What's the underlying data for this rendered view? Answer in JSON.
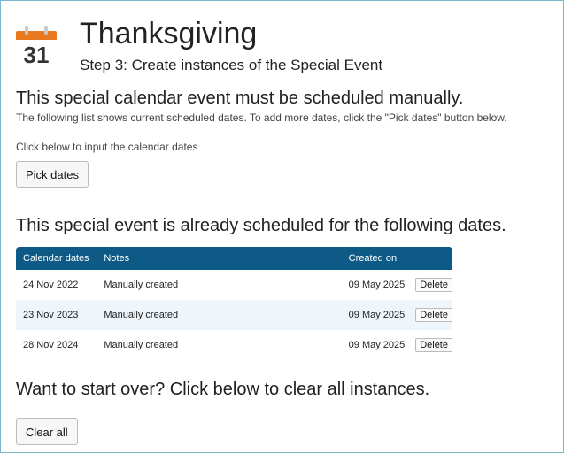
{
  "header": {
    "icon_day": "31",
    "title": "Thanksgiving",
    "subtitle": "Step 3: Create instances of the Special Event"
  },
  "manual": {
    "heading": "This special calendar event must be scheduled manually.",
    "description": "The following list shows current scheduled dates. To add more dates, click the \"Pick dates\" button below.",
    "instruction": "Click below to input the calendar dates",
    "pick_button": "Pick dates"
  },
  "scheduled": {
    "heading": "This special event is already scheduled for the following dates.",
    "columns": [
      "Calendar dates",
      "Notes",
      "Created on",
      ""
    ],
    "rows": [
      {
        "date": "24 Nov 2022",
        "notes": "Manually created",
        "created": "09 May 2025",
        "action": "Delete"
      },
      {
        "date": "23 Nov 2023",
        "notes": "Manually created",
        "created": "09 May 2025",
        "action": "Delete"
      },
      {
        "date": "28 Nov 2024",
        "notes": "Manually created",
        "created": "09 May 2025",
        "action": "Delete"
      }
    ]
  },
  "reset": {
    "heading": "Want to start over? Click below to clear all instances.",
    "clear_button": "Clear all"
  },
  "colors": {
    "table_header": "#0d5a86",
    "row_alt": "#eef5fb",
    "calendar_icon": "#e8791f",
    "frame_border": "#7fb6cf"
  }
}
